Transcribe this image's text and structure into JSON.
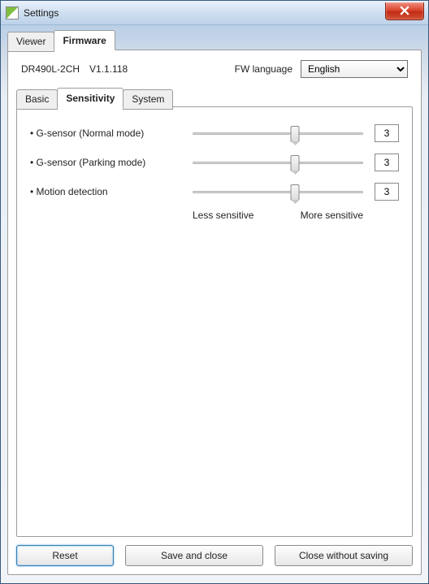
{
  "window": {
    "title": "Settings"
  },
  "outerTabs": {
    "viewer": "Viewer",
    "firmware": "Firmware",
    "active": "firmware"
  },
  "firmware": {
    "model": "DR490L-2CH",
    "version": "V1.1.118",
    "langLabel": "FW language",
    "langValue": "English"
  },
  "innerTabs": {
    "basic": "Basic",
    "sensitivity": "Sensitivity",
    "system": "System",
    "active": "sensitivity"
  },
  "sensitivity": {
    "rows": [
      {
        "label": "G-sensor (Normal mode)",
        "value": "3",
        "pos": 60
      },
      {
        "label": "G-sensor (Parking mode)",
        "value": "3",
        "pos": 60
      },
      {
        "label": "Motion detection",
        "value": "3",
        "pos": 60
      }
    ],
    "legendLess": "Less sensitive",
    "legendMore": "More sensitive"
  },
  "buttons": {
    "reset": "Reset",
    "save": "Save and close",
    "close": "Close without saving"
  }
}
